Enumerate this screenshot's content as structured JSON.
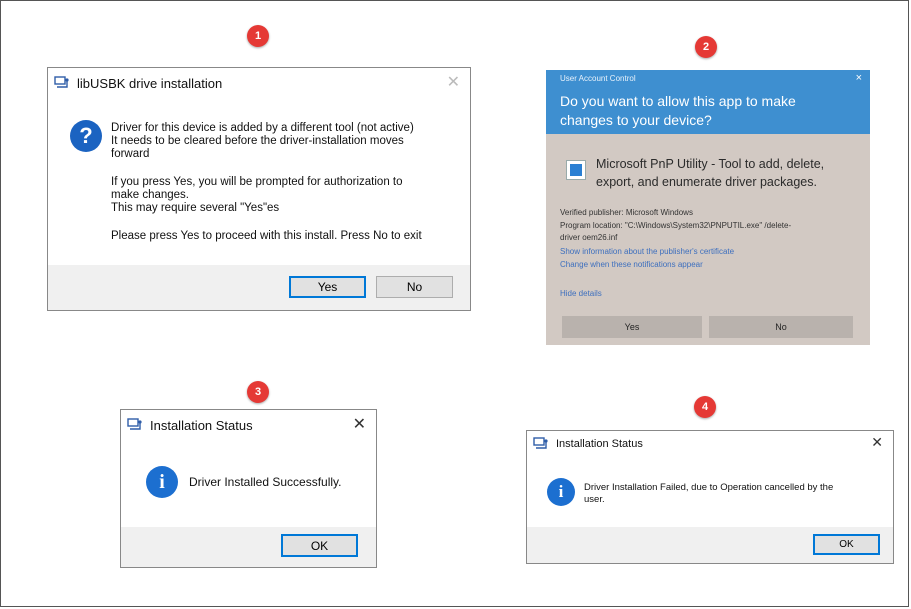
{
  "steps": [
    "1",
    "2",
    "3",
    "4"
  ],
  "dialog1": {
    "title": "libUSBK drive installation",
    "icon": "question-icon",
    "line1": "Driver for this device is added by a different tool (not active)",
    "line2": "It needs to be cleared before the driver-installation moves",
    "line3": "forward",
    "line4": "If you press Yes, you will be prompted for authorization  to",
    "line5": "make changes.",
    "line6": "This may require several \"Yes\"es",
    "line7": "Please press Yes to proceed with this install. Press No to exit",
    "yes": "Yes",
    "no": "No"
  },
  "uac": {
    "header_small": "User Account Control",
    "close": "×",
    "question_line1": "Do you want to allow this app to make",
    "question_line2": "changes to your device?",
    "app_line1": "Microsoft PnP Utility - Tool to add, delete,",
    "app_line2": "export, and enumerate driver packages.",
    "publisher": "Verified publisher: Microsoft Windows",
    "location_line1": "Program location: \"C:\\Windows\\System32\\PNPUTIL.exe\" /delete-",
    "location_line2": "driver oem26.inf",
    "link_certificate": "Show information about the publisher's certificate",
    "link_notifications": "Change when these notifications appear",
    "link_hide": "Hide details",
    "yes": "Yes",
    "no": "No",
    "colors": {
      "header": "#3e8fd0",
      "body": "#d2c9c3"
    }
  },
  "dialog3": {
    "title": "Installation Status",
    "icon": "info-icon",
    "message": "Driver Installed Successfully.",
    "ok": "OK"
  },
  "dialog4": {
    "title": "Installation Status",
    "icon": "info-icon",
    "message_line1": "Driver Installation Failed, due to Operation cancelled by the",
    "message_line2": "user.",
    "ok": "OK"
  },
  "common": {
    "close_glyph": "✕",
    "info_glyph": "i",
    "question_glyph": "?"
  }
}
